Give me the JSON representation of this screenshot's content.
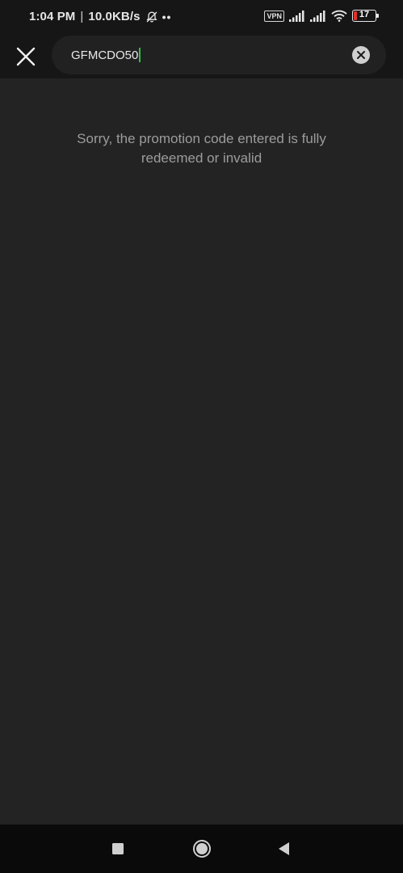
{
  "status_bar": {
    "time": "1:04 PM",
    "separator": "|",
    "network_speed": "10.0KB/s",
    "more_indicator": "••",
    "vpn_label": "VPN",
    "battery_level": "17",
    "battery_fraction": 0.17,
    "battery_color": "#e0312b",
    "icons": [
      "bell-off-icon",
      "signal-icon",
      "signal-icon",
      "wifi-icon",
      "battery-icon"
    ]
  },
  "search": {
    "value": "GFMCDO50",
    "close_icon": "close-icon",
    "clear_icon": "clear-icon",
    "caret_color": "#2fbf4a"
  },
  "main": {
    "message": "Sorry, the promotion code entered is fully redeemed or invalid"
  },
  "nav_bar": {
    "icons": [
      "recent-apps-icon",
      "home-icon",
      "back-icon"
    ]
  }
}
